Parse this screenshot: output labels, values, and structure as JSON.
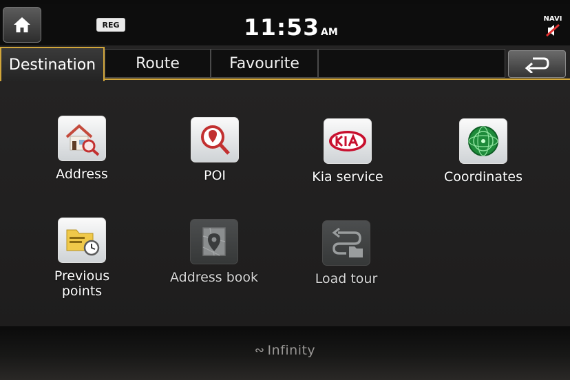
{
  "status_bar": {
    "reg_badge": "REG",
    "time": "11:53",
    "ampm": "AM",
    "navi_label": "NAVI"
  },
  "tabs": [
    {
      "label": "Destination",
      "active": true
    },
    {
      "label": "Route",
      "active": false
    },
    {
      "label": "Favourite",
      "active": false
    }
  ],
  "menu": {
    "row1": [
      {
        "label": "Address",
        "icon": "house-magnifier-icon"
      },
      {
        "label": "POI",
        "icon": "poi-pin-magnifier-icon"
      },
      {
        "label": "Kia service",
        "icon": "kia-logo-icon"
      },
      {
        "label": "Coordinates",
        "icon": "globe-grid-icon"
      }
    ],
    "row2": [
      {
        "label_line1": "Previous",
        "label_line2": "points",
        "icon": "folder-clock-icon"
      },
      {
        "label": "Address book",
        "icon": "map-pin-book-icon",
        "disabled": true
      },
      {
        "label": "Load tour",
        "icon": "route-folder-icon",
        "disabled": true
      }
    ]
  },
  "device": {
    "brand": "Infinity"
  },
  "colors": {
    "accent": "#d2a63a",
    "status_bar": "#0d0d0d",
    "screen_bg": "#232222"
  }
}
